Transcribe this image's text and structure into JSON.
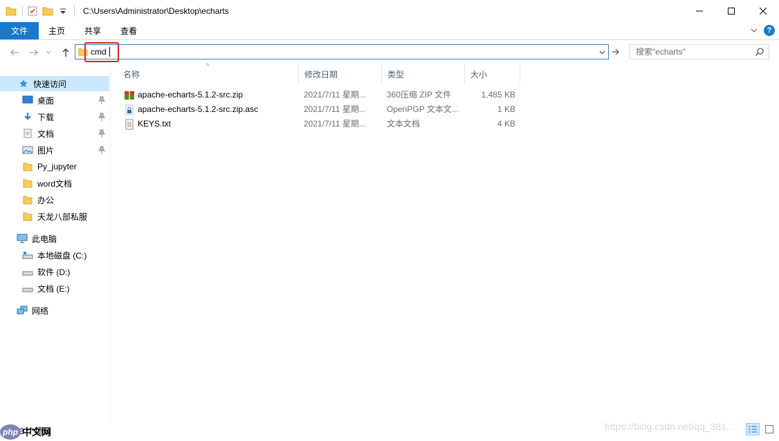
{
  "titlebar": {
    "path": "C:\\Users\\Administrator\\Desktop\\echarts",
    "quick_access_icons": [
      "folder-icon",
      "properties-icon",
      "new-folder-icon",
      "customize-quick-access-icon"
    ],
    "controls": [
      "minimize",
      "maximize",
      "close"
    ]
  },
  "ribbon": {
    "tabs": [
      {
        "label": "文件",
        "active": true
      },
      {
        "label": "主页"
      },
      {
        "label": "共享"
      },
      {
        "label": "查看"
      }
    ]
  },
  "address": {
    "value": "cmd",
    "search_placeholder": "搜索\"echarts\""
  },
  "sidebar": {
    "items": [
      {
        "label": "快速访问",
        "icon": "star-icon",
        "selected": true
      },
      {
        "label": "桌面",
        "icon": "desktop-icon",
        "pinned": true
      },
      {
        "label": "下载",
        "icon": "download-icon",
        "pinned": true
      },
      {
        "label": "文档",
        "icon": "document-icon",
        "pinned": true
      },
      {
        "label": "图片",
        "icon": "picture-icon",
        "pinned": true
      },
      {
        "label": "Py_jupyter",
        "icon": "folder-icon"
      },
      {
        "label": "word文档",
        "icon": "folder-icon"
      },
      {
        "label": "办公",
        "icon": "folder-icon"
      },
      {
        "label": "天龙八部私服",
        "icon": "folder-icon"
      },
      {
        "label": "此电脑",
        "icon": "computer-icon"
      },
      {
        "label": "本地磁盘 (C:)",
        "icon": "drive-icon"
      },
      {
        "label": "软件 (D:)",
        "icon": "drive-icon"
      },
      {
        "label": "文档 (E:)",
        "icon": "drive-icon"
      },
      {
        "label": "网络",
        "icon": "network-icon"
      }
    ]
  },
  "columns": [
    "名称",
    "修改日期",
    "类型",
    "大小"
  ],
  "files": [
    {
      "name": "apache-echarts-5.1.2-src.zip",
      "modified": "2021/7/11 星期...",
      "type": "360压缩 ZIP 文件",
      "size": "1,485 KB",
      "icon": "zip-archive-icon"
    },
    {
      "name": "apache-echarts-5.1.2-src.zip.asc",
      "modified": "2021/7/11 星期...",
      "type": "OpenPGP 文本文...",
      "size": "1 KB",
      "icon": "lock-file-icon"
    },
    {
      "name": "KEYS.txt",
      "modified": "2021/7/11 星期...",
      "type": "文本文档",
      "size": "4 KB",
      "icon": "text-file-icon"
    }
  ],
  "status": {
    "items_label": "3 个项目"
  },
  "watermarks": {
    "left_badge": "php",
    "left_text": "中文网",
    "right_text": "https://blog.csdn.net/qq_381..."
  },
  "colors": {
    "accent": "#1979ca",
    "selection": "#cce8ff",
    "highlight_box": "#e02020"
  }
}
